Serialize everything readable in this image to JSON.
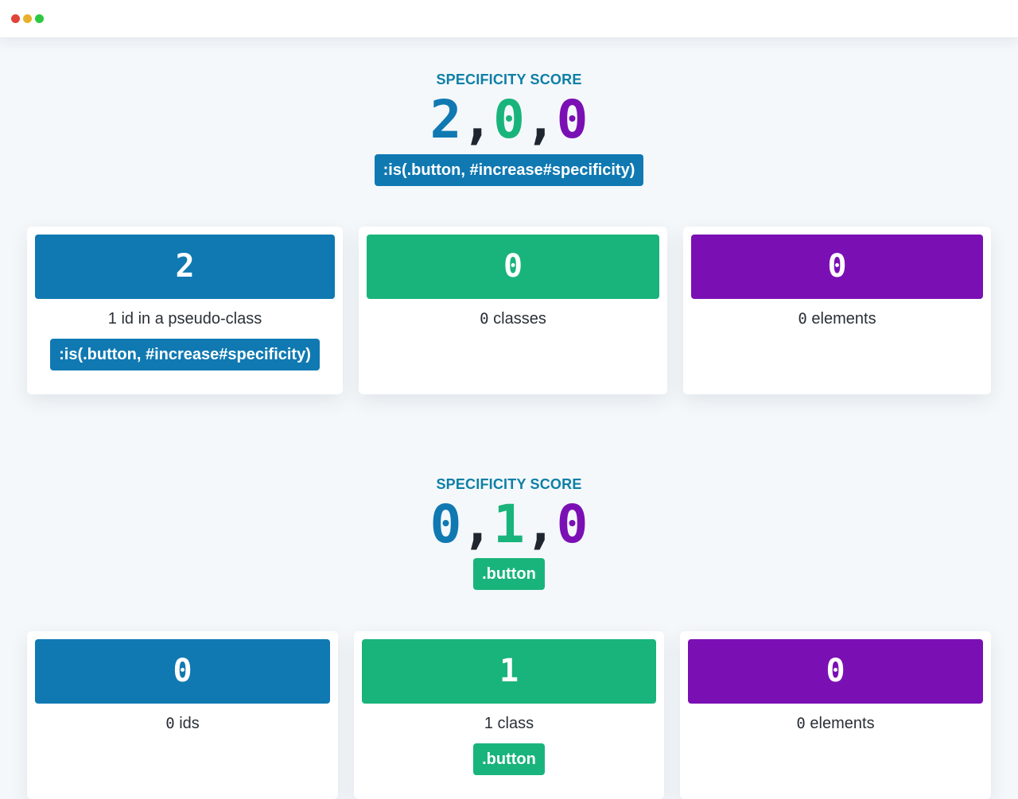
{
  "window": {
    "controls": [
      "close",
      "minimize",
      "maximize"
    ]
  },
  "colors": {
    "ids": "#1079b2",
    "classes": "#19b47b",
    "elements": "#7a10b4",
    "heading": "#0e7fa6"
  },
  "results": [
    {
      "heading": "SPECIFICITY SCORE",
      "score": {
        "ids": "2",
        "classes": "0",
        "elements": "0",
        "separator": ","
      },
      "selector": ":is(.button, #increase#specificity)",
      "cards": {
        "ids": {
          "value": "2",
          "label": "1 id in a pseudo-class",
          "chip": ":is(.button, #increase#specificity)"
        },
        "classes": {
          "value": "0",
          "count": "0",
          "label": "classes"
        },
        "elements": {
          "value": "0",
          "count": "0",
          "label": "elements"
        }
      }
    },
    {
      "heading": "SPECIFICITY SCORE",
      "score": {
        "ids": "0",
        "classes": "1",
        "elements": "0",
        "separator": ","
      },
      "selector": ".button",
      "cards": {
        "ids": {
          "value": "0",
          "count": "0",
          "label": "ids"
        },
        "classes": {
          "value": "1",
          "label": "1 class",
          "chip": ".button"
        },
        "elements": {
          "value": "0",
          "count": "0",
          "label": "elements"
        }
      }
    }
  ]
}
